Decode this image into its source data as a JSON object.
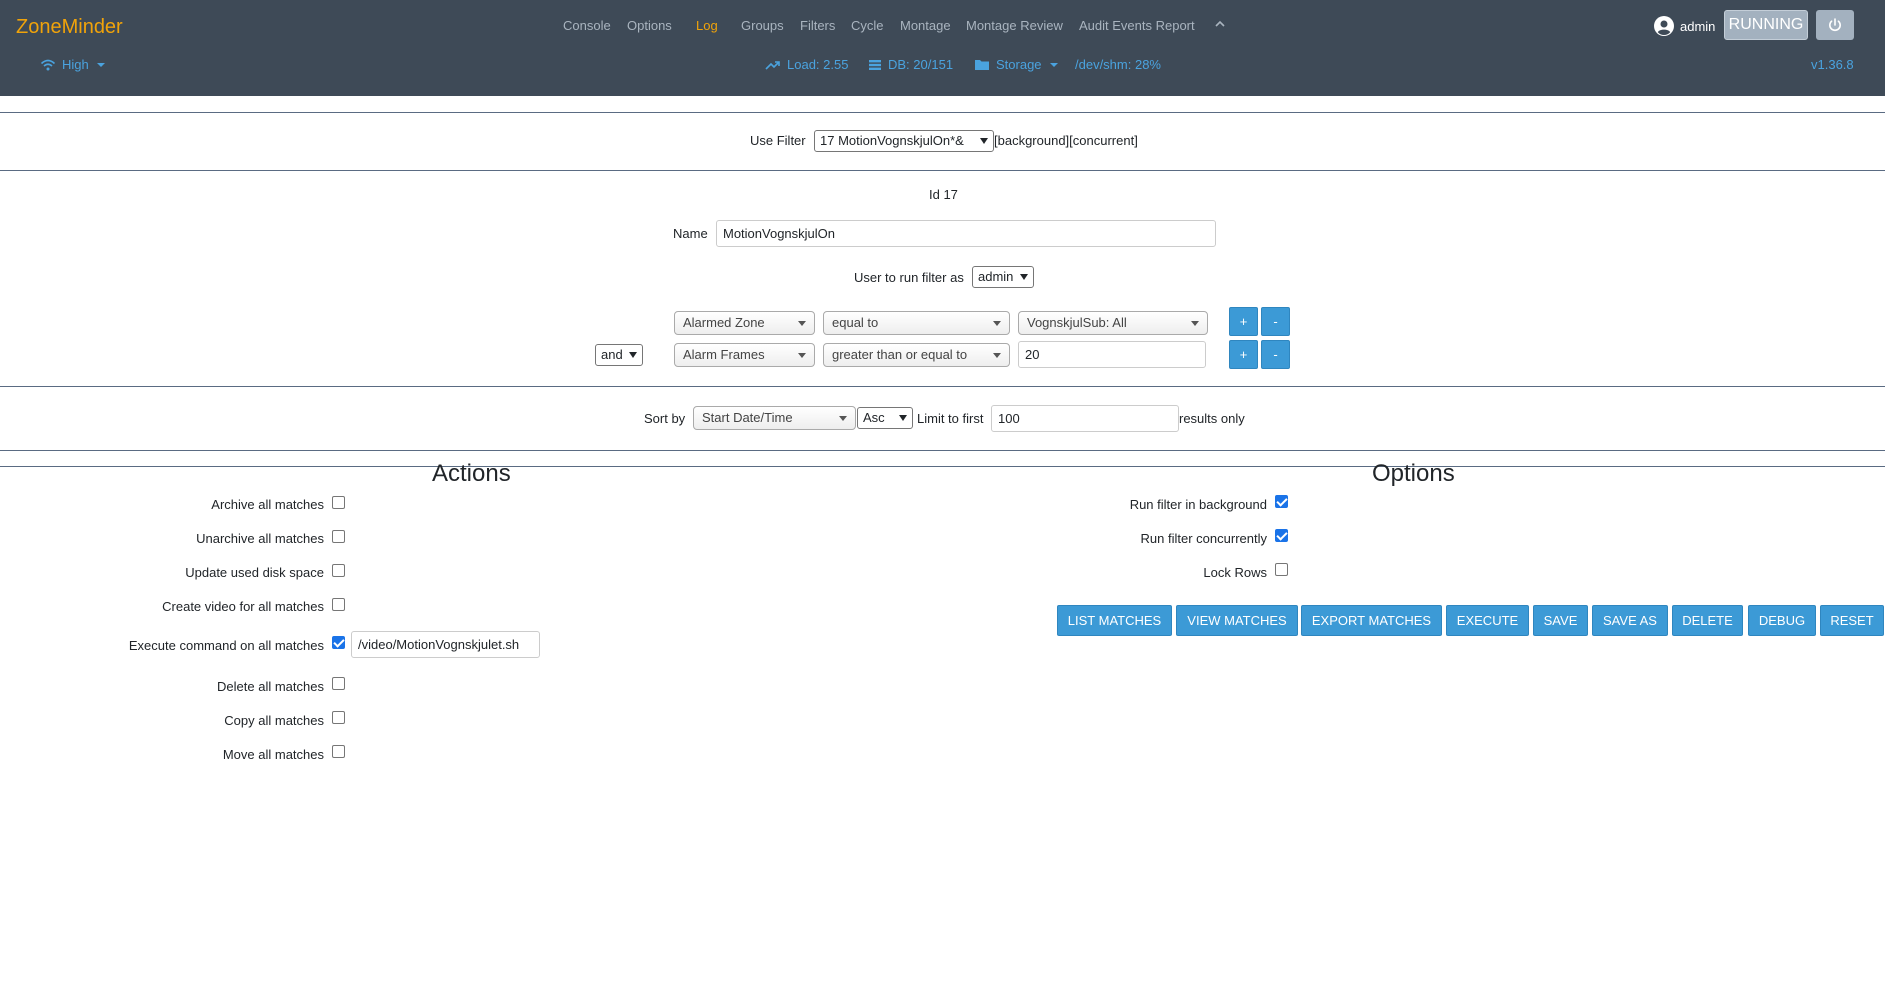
{
  "header": {
    "brand": "ZoneMinder",
    "nav": [
      {
        "label": "Console",
        "active": false
      },
      {
        "label": "Options",
        "active": false
      },
      {
        "label": "Log",
        "active": true
      },
      {
        "label": "Groups",
        "active": false
      },
      {
        "label": "Filters",
        "active": false
      },
      {
        "label": "Cycle",
        "active": false
      },
      {
        "label": "Montage",
        "active": false
      },
      {
        "label": "Montage Review",
        "active": false
      },
      {
        "label": "Audit Events Report",
        "active": false
      }
    ],
    "user": "admin",
    "state_button": "RUNNING",
    "bandwidth": "High",
    "load": "Load: 2.55",
    "db": "DB: 20/151",
    "storage": "Storage",
    "shm": "/dev/shm: 28%",
    "version": "v1.36.8",
    "colors": {
      "bar": "#3e4a57",
      "brand": "#f0a30a",
      "link": "#4aa3df",
      "active": "#f0a30a"
    }
  },
  "filter_select": {
    "label": "Use Filter",
    "value": "17 MotionVognskjulOn*&",
    "flags": "[background][concurrent]"
  },
  "filter": {
    "id_text": "Id 17",
    "name_label": "Name",
    "name_value": "MotionVognskjulOn",
    "user_label": "User to run filter as",
    "user_value": "admin"
  },
  "terms": [
    {
      "conj": "",
      "attr": "Alarmed Zone",
      "op": "equal to",
      "value": "VognskjulSub: All",
      "add": "+",
      "remove": "-"
    },
    {
      "conj": "and",
      "attr": "Alarm Frames",
      "op": "greater than or equal to",
      "value": "20",
      "add": "+",
      "remove": "-"
    }
  ],
  "sort": {
    "label": "Sort by",
    "field": "Start Date/Time",
    "direction": "Asc",
    "limit_label": "Limit to first",
    "limit_value": "100",
    "results_label": "results only"
  },
  "actions": {
    "title": "Actions",
    "items": [
      {
        "label": "Archive all matches",
        "checked": false
      },
      {
        "label": "Unarchive all matches",
        "checked": false
      },
      {
        "label": "Update used disk space",
        "checked": false
      },
      {
        "label": "Create video for all matches",
        "checked": false
      },
      {
        "label": "Execute command on all matches",
        "checked": true
      },
      {
        "label": "Delete all matches",
        "checked": false
      },
      {
        "label": "Copy all matches",
        "checked": false
      },
      {
        "label": "Move all matches",
        "checked": false
      }
    ],
    "command_value": "/video/MotionVognskjulet.sh"
  },
  "options": {
    "title": "Options",
    "items": [
      {
        "label": "Run filter in background",
        "checked": true
      },
      {
        "label": "Run filter concurrently",
        "checked": true
      },
      {
        "label": "Lock Rows",
        "checked": false
      }
    ]
  },
  "buttons": [
    "LIST MATCHES",
    "VIEW MATCHES",
    "EXPORT MATCHES",
    "EXECUTE",
    "SAVE",
    "SAVE AS",
    "DELETE",
    "DEBUG",
    "RESET"
  ]
}
